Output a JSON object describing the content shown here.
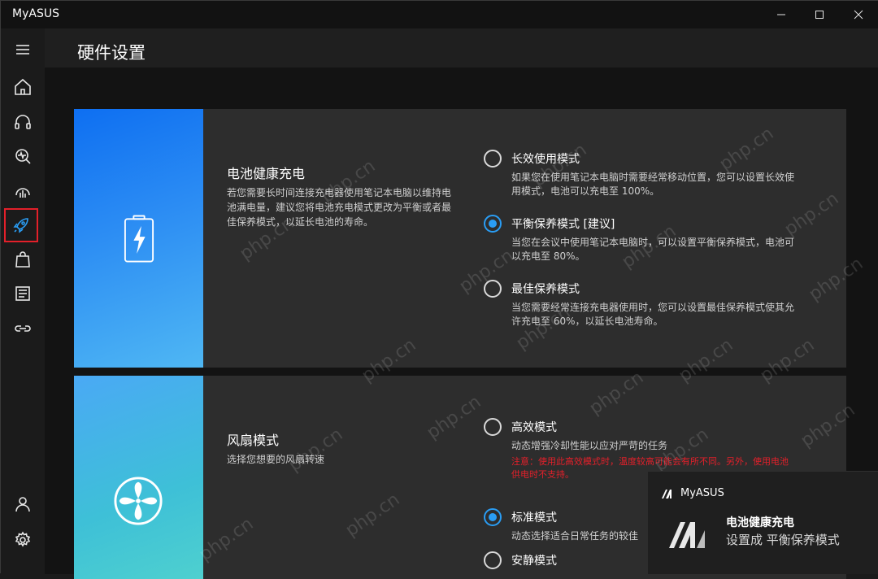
{
  "window": {
    "title": "MyASUS"
  },
  "nav": {
    "items": [
      {
        "icon": "menu-icon"
      },
      {
        "icon": "home-icon"
      },
      {
        "icon": "headset-icon"
      },
      {
        "icon": "diagnostics-icon"
      },
      {
        "icon": "system-icon"
      },
      {
        "icon": "rocket-icon",
        "active": true
      },
      {
        "icon": "bag-icon"
      },
      {
        "icon": "news-icon"
      },
      {
        "icon": "link-icon"
      },
      {
        "icon": "user-icon"
      },
      {
        "icon": "gear-icon"
      }
    ],
    "active_color": "#2a9df4",
    "highlight_color": "#e3202a"
  },
  "header": {
    "title": "硬件设置"
  },
  "battery": {
    "title": "电池健康充电",
    "description": "若您需要长时间连接充电器使用笔记本电脑以维持电池满电量，建议您将电池充电模式更改为平衡或者最佳保养模式，以延长电池的寿命。",
    "options": [
      {
        "label": "长效使用模式",
        "desc": "如果您在使用笔记本电脑时需要经常移动位置，您可以设置长效使用模式，电池可以充电至 100%。",
        "selected": false
      },
      {
        "label": "平衡保养模式 [建议]",
        "desc": "当您在会议中使用笔记本电脑时，可以设置平衡保养模式，电池可以充电至 80%。",
        "selected": true
      },
      {
        "label": "最佳保养模式",
        "desc": "当您需要经常连接充电器使用时，您可以设置最佳保养模式使其允许充电至 60%，以延长电池寿命。",
        "selected": false
      }
    ]
  },
  "fan": {
    "title": "风扇模式",
    "description": "选择您想要的风扇转速",
    "options": [
      {
        "label": "高效模式",
        "desc": "动态增强冷却性能以应对严苛的任务",
        "warning": "注意：使用此高效模式时，温度较高可能会有所不同。另外，使用电池供电时不支持。",
        "selected": false
      },
      {
        "label": "标准模式",
        "desc": "动态选择适合日常任务的较佳",
        "selected": true
      },
      {
        "label": "安静模式",
        "desc": "",
        "selected": false
      }
    ]
  },
  "toast": {
    "app_name": "MyASUS",
    "title": "电池健康充电",
    "body": "设置成 平衡保养模式"
  },
  "watermark": {
    "text": "php.cn"
  }
}
